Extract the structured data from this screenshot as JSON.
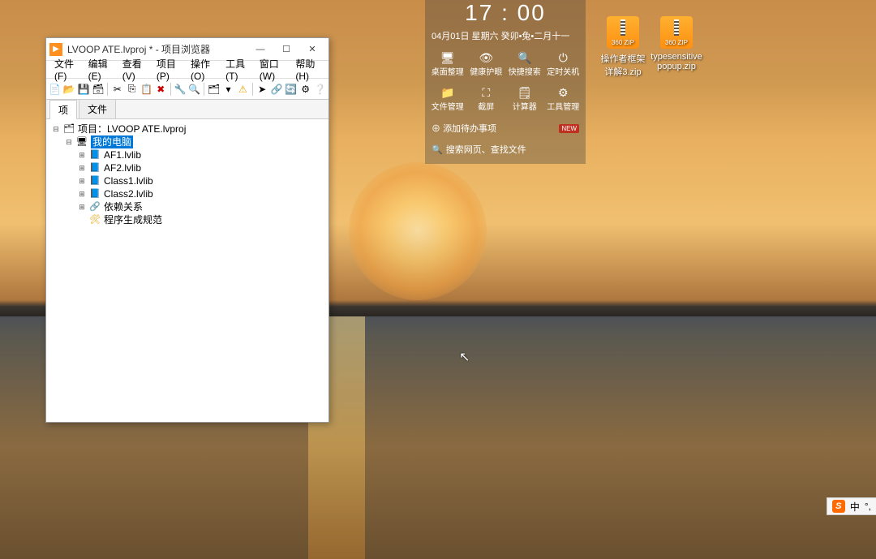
{
  "window": {
    "title": "LVOOP ATE.lvproj * - 项目浏览器",
    "menus": [
      "文件(F)",
      "编辑(E)",
      "查看(V)",
      "项目(P)",
      "操作(O)",
      "工具(T)",
      "窗口(W)",
      "帮助(H)"
    ],
    "tabs": [
      "项",
      "文件"
    ],
    "tree": {
      "root": "项目：LVOOP ATE.lvproj",
      "my_computer": "我的电脑",
      "items": [
        "AF1.lvlib",
        "AF2.lvlib",
        "Class1.lvlib",
        "Class2.lvlib",
        "依赖关系",
        "程序生成规范"
      ]
    }
  },
  "widget": {
    "time": "17 : 00",
    "dateline": "04月01日  星期六  癸卯•兔•二月十一",
    "row1": [
      {
        "glyph": "🖥",
        "label": "桌面整理"
      },
      {
        "glyph": "👁",
        "label": "健康护眼"
      },
      {
        "glyph": "🔍",
        "label": "快捷搜索"
      },
      {
        "glyph": "⏻",
        "label": "定时关机"
      }
    ],
    "row2": [
      {
        "glyph": "📁",
        "label": "文件管理"
      },
      {
        "glyph": "⛶",
        "label": "截屏"
      },
      {
        "glyph": "🗒",
        "label": "计算器"
      },
      {
        "glyph": "⚙",
        "label": "工具管理"
      }
    ],
    "addtodo": "添加待办事项",
    "newbadge": "NEW",
    "search_placeholder": "搜索网页、查找文件"
  },
  "desktop_icons": [
    {
      "name": "操作者框架详解3.zip"
    },
    {
      "name": "typesensitive popup.zip"
    }
  ],
  "ime": {
    "mode": "中"
  }
}
